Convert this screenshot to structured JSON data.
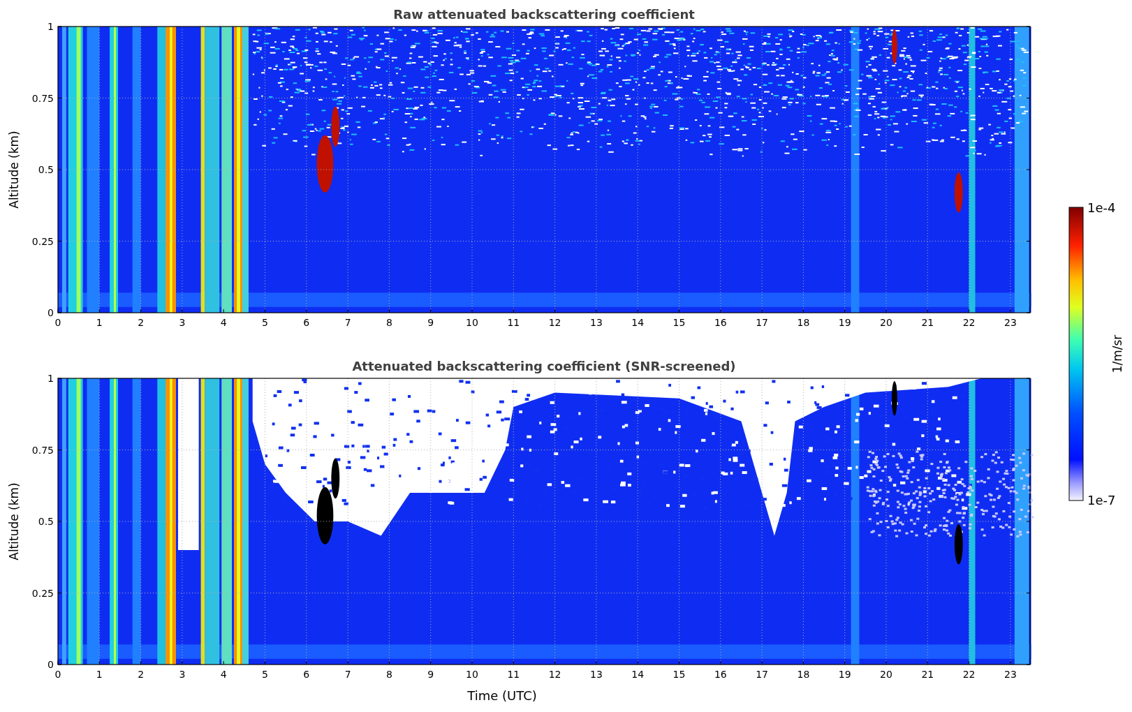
{
  "panels": [
    {
      "kind": "raw",
      "title": "Raw attenuated backscattering coefficient",
      "ylabel": "Altitude (km)",
      "yticks": [
        "1",
        "0.75",
        "0.5",
        "0.25",
        "0"
      ],
      "xticks": [
        "0",
        "1",
        "2",
        "3",
        "4",
        "5",
        "6",
        "7",
        "8",
        "9",
        "10",
        "11",
        "12",
        "13",
        "14",
        "15",
        "16",
        "17",
        "18",
        "19",
        "20",
        "21",
        "22",
        "23"
      ]
    },
    {
      "kind": "screened",
      "title": "Attenuated backscattering coefficient (SNR-screened)",
      "ylabel": "Altitude (km)",
      "yticks": [
        "1",
        "0.75",
        "0.5",
        "0.25",
        "0"
      ],
      "xticks": [
        "0",
        "1",
        "2",
        "3",
        "4",
        "5",
        "6",
        "7",
        "8",
        "9",
        "10",
        "11",
        "12",
        "13",
        "14",
        "15",
        "16",
        "17",
        "18",
        "19",
        "20",
        "21",
        "22",
        "23"
      ],
      "xlabel": "Time (UTC)"
    }
  ],
  "colorbar": {
    "max": "1e-4",
    "min": "1e-7",
    "label": "1/m/sr"
  }
}
